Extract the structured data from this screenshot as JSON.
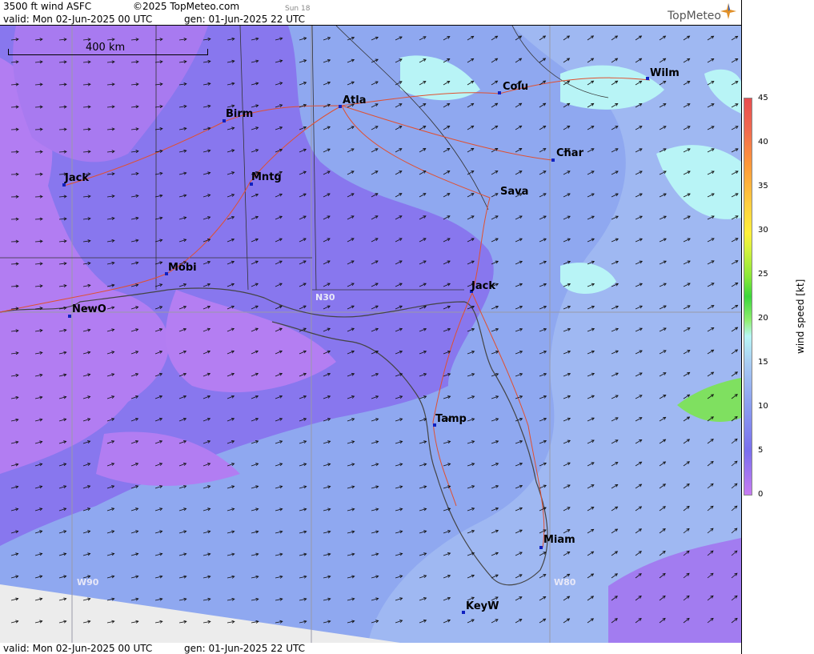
{
  "header": {
    "product": "3500 ft wind ASFC",
    "copyright": "©2025 TopMeteo.com",
    "run_info": "Sun 18",
    "valid": "valid:  Mon  02-Jun-2025  00 UTC",
    "gen": "gen: 01-Jun-2025 22 UTC",
    "logo_text": "TopMeteo"
  },
  "footer": {
    "valid": "valid:  Mon  02-Jun-2025  00 UTC",
    "gen": "gen: 01-Jun-2025 22 UTC"
  },
  "map": {
    "scale_label": "400 km",
    "grid_labels": [
      "N30",
      "W90",
      "W80"
    ],
    "cities": [
      {
        "name": "Wilm"
      },
      {
        "name": "Colu"
      },
      {
        "name": "Atla"
      },
      {
        "name": "Birm"
      },
      {
        "name": "Char"
      },
      {
        "name": "Jack"
      },
      {
        "name": "Mntg"
      },
      {
        "name": "Sava"
      },
      {
        "name": "Mobi"
      },
      {
        "name": "Jack"
      },
      {
        "name": "NewO"
      },
      {
        "name": "Tamp"
      },
      {
        "name": "Miam"
      },
      {
        "name": "KeyW"
      }
    ]
  },
  "legend": {
    "label": "wind speed [kt]",
    "ticks": [
      "45",
      "40",
      "35",
      "30",
      "25",
      "20",
      "15",
      "10",
      "5",
      "0"
    ],
    "colors": {
      "low": "#c77cf2",
      "mid": "#8a9cf0",
      "cyan": "#b8f6f6",
      "green": "#3cd63c",
      "high": "#e84e50"
    }
  }
}
